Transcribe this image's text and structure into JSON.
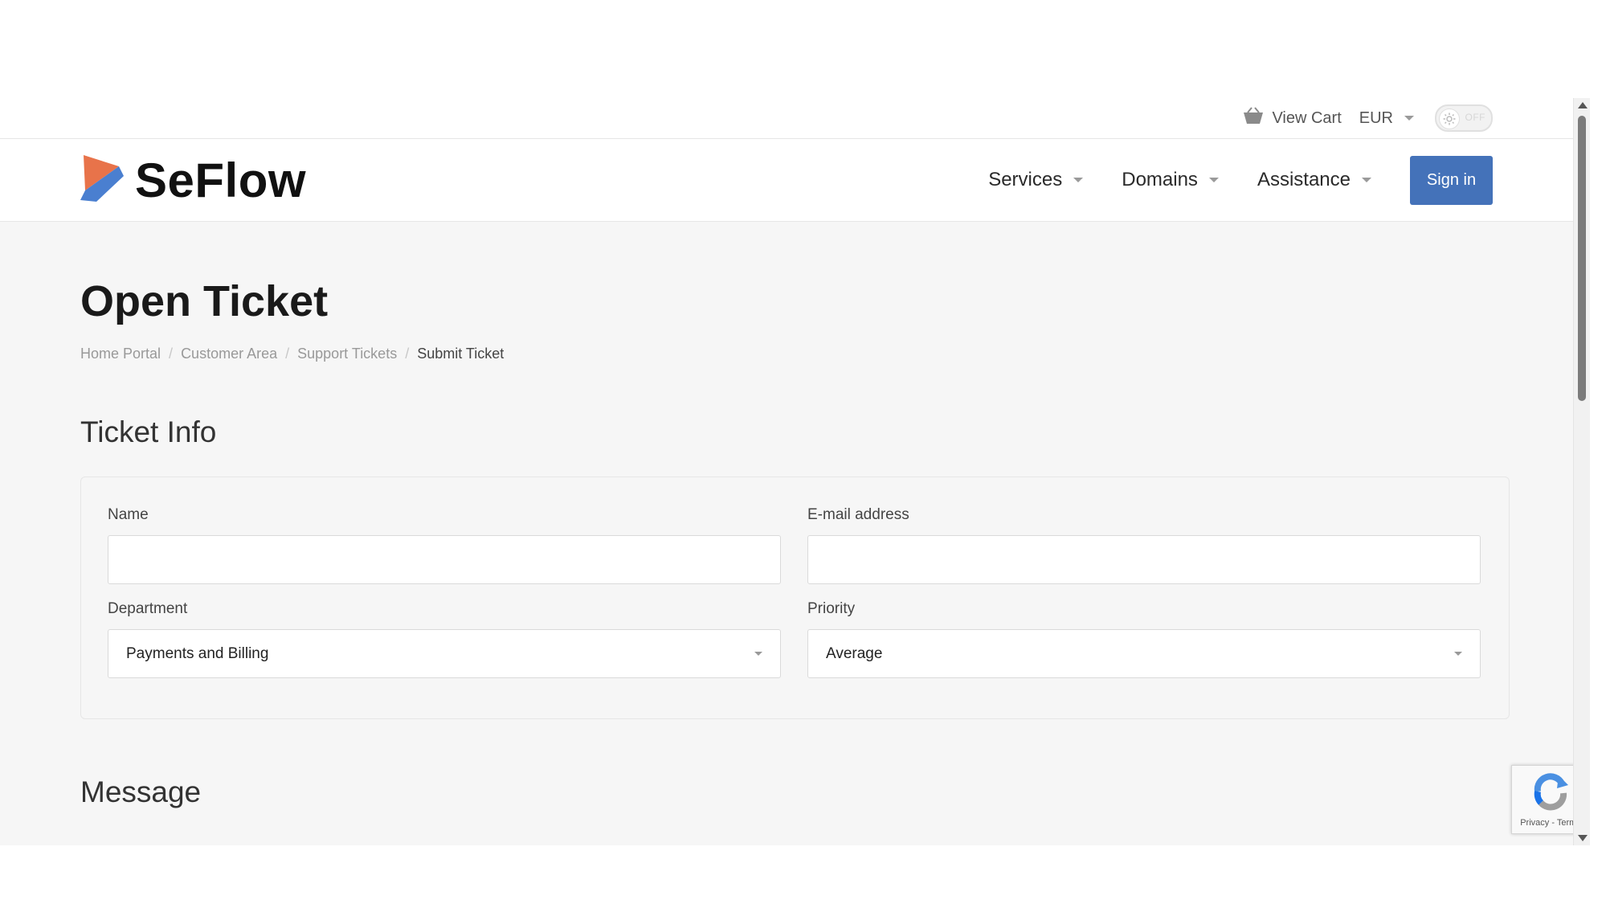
{
  "topbar": {
    "cart_label": "View Cart",
    "currency": "EUR",
    "theme_toggle_state": "OFF"
  },
  "brand": {
    "name": "SeFlow"
  },
  "nav": {
    "items": [
      {
        "label": "Services"
      },
      {
        "label": "Domains"
      },
      {
        "label": "Assistance"
      }
    ],
    "signin_label": "Sign in"
  },
  "page": {
    "title": "Open Ticket",
    "breadcrumb": [
      "Home Portal",
      "Customer Area",
      "Support Tickets",
      "Submit Ticket"
    ]
  },
  "ticket_info": {
    "heading": "Ticket Info",
    "name_label": "Name",
    "name_value": "",
    "email_label": "E-mail address",
    "email_value": "",
    "department_label": "Department",
    "department_value": "Payments and Billing",
    "priority_label": "Priority",
    "priority_value": "Average"
  },
  "message": {
    "heading": "Message"
  },
  "recaptcha": {
    "links": "Privacy - Terms"
  },
  "colors": {
    "accent": "#4472b9",
    "logo_orange": "#e8734a",
    "logo_blue": "#4a7fd0"
  }
}
